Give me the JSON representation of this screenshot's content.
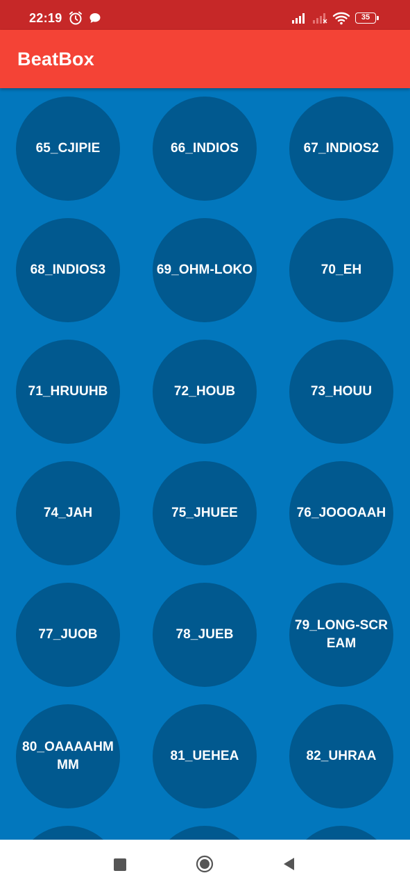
{
  "status_bar": {
    "time": "22:19",
    "battery": "35",
    "icons": [
      "alarm-icon",
      "chat-icon",
      "signal-icon",
      "signal-off-icon",
      "wifi-icon",
      "battery-icon"
    ]
  },
  "app_bar": {
    "title": "BeatBox"
  },
  "colors": {
    "status_bar": "#c62828",
    "app_bar": "#f44336",
    "background": "#0277bd",
    "button": "#01598f",
    "nav_bar": "#ffffff"
  },
  "sounds": [
    "65_CJIPIE",
    "66_INDIOS",
    "67_INDIOS2",
    "68_INDIOS3",
    "69_OHM-LOKO",
    "70_EH",
    "71_HRUUHB",
    "72_HOUB",
    "73_HOUU",
    "74_JAH",
    "75_JHUEE",
    "76_JOOOAAH",
    "77_JUOB",
    "78_JUEB",
    "79_LONG-SCREAM",
    "80_OAAAAHMMM",
    "81_UEHEA",
    "82_UHRAA",
    "",
    "",
    ""
  ],
  "nav_bar": {
    "icons": [
      "recents-square-icon",
      "home-circle-icon",
      "back-triangle-icon"
    ]
  }
}
